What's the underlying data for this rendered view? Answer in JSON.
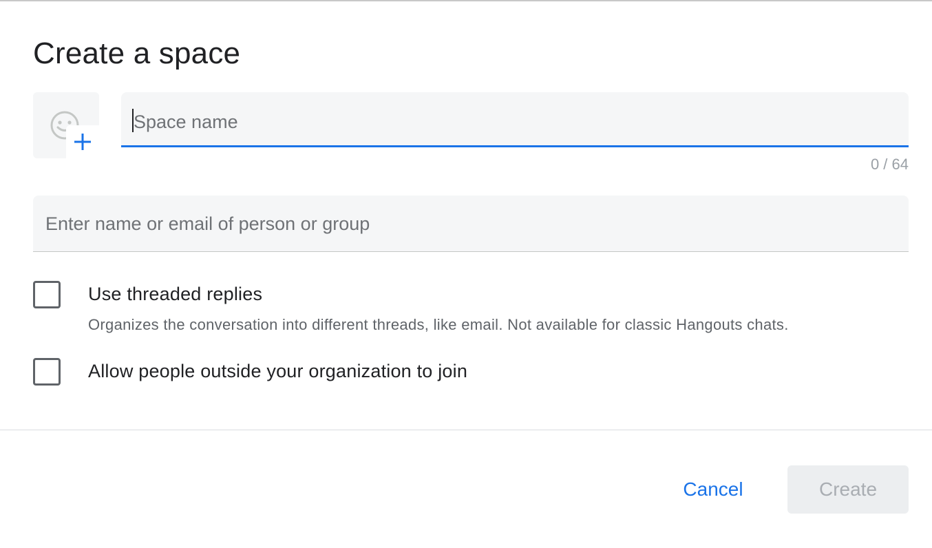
{
  "dialog": {
    "title": "Create a space"
  },
  "space_name": {
    "value": "",
    "placeholder": "Space name",
    "counter": "0 / 64"
  },
  "people": {
    "value": "",
    "placeholder": "Enter name or email of person or group"
  },
  "options": [
    {
      "label": "Use threaded replies",
      "description": "Organizes the conversation into different threads, like email. Not available for classic Hangouts chats.",
      "checked": false
    },
    {
      "label": "Allow people outside your organization to join",
      "checked": false
    }
  ],
  "actions": {
    "cancel_label": "Cancel",
    "create_label": "Create",
    "create_enabled": false
  },
  "colors": {
    "accent": "#1a73e8",
    "text_primary": "#202124",
    "text_secondary": "#5f6368",
    "field_background": "#f5f6f7",
    "disabled_button_bg": "#eceef0",
    "disabled_button_text": "#a9adb2"
  },
  "icons": {
    "avatar_picker": "emoji-smile-icon",
    "avatar_add": "plus-icon"
  }
}
